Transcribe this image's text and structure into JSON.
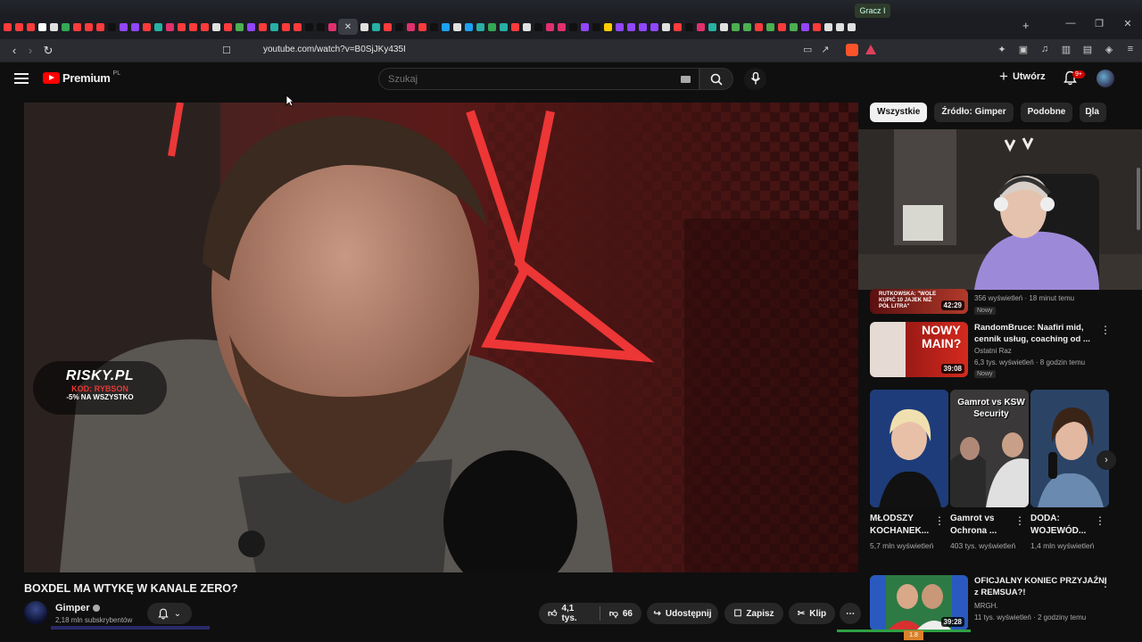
{
  "browser": {
    "gamer_badge": "Gracz I",
    "url": "youtube.com/watch?v=B0SjJKy435I",
    "win_controls": [
      "—",
      "❐",
      "✕"
    ],
    "new_tab": "+",
    "tab_colors": [
      "#ff3b3b",
      "#ff3b3b",
      "#ff3b3b",
      "#ffffff",
      "#e0e0e0",
      "#34a853",
      "#ff3b3b",
      "#ff3b3b",
      "#ff3b3b",
      "#111111",
      "#9146ff",
      "#9146ff",
      "#ff3b3b",
      "#27b0a4",
      "#e1306c",
      "#ff3b3b",
      "#ff3b3b",
      "#ff3b3b",
      "#e0e0e0",
      "#ff3b3b",
      "#4caf50",
      "#9146ff",
      "#ff3b3b",
      "#27b0a4",
      "#ff3b3b",
      "#ff3b3b",
      "#111111",
      "#111111",
      "#e1306c"
    ]
  },
  "masthead": {
    "logo_text": "Premium",
    "country": "PL",
    "search_placeholder": "Szukaj",
    "create_label": "Utwórz",
    "notif_count": "9+"
  },
  "video": {
    "promo_brand": "RISKY.PL",
    "promo_code": "KOD: RYBSON",
    "promo_offer": "-5% NA WSZYSTKO",
    "title": "BOXDEL MA WTYKĘ W KANALE ZERO?",
    "channel": "Gimper",
    "subscribers": "2,18 mln subskrybentów",
    "likes": "4,1 tys.",
    "dislikes": "66",
    "share": "Udostępnij",
    "save": "Zapisz",
    "clip": "Klip"
  },
  "chips": [
    "Wszystkie",
    "Źródło: Gimper",
    "Podobne",
    "Dla"
  ],
  "recommended": [
    {
      "title": "",
      "channel": "",
      "meta": "356 wyświetleń · 18 minut temu",
      "duration": "42:29",
      "badge": "Nowy",
      "thumb_text": "RUTKOWSKA: \"WOLE KUPIĆ 10 JAJEK NIŻ PÓŁ LITRA\""
    },
    {
      "title": "RandomBruce: Naafiri mid, cennik usług, coaching od ...",
      "channel": "Ostatni Raz",
      "meta": "6,3 tys. wyświetleń · 8 godzin temu",
      "duration": "39:08",
      "badge": "Nowy",
      "thumb_text": "NOWY MAIN?"
    },
    {
      "title": "OFICJALNY KONIEC PRZYJAŹNI z REMSUA?!",
      "channel": "MRGH.",
      "meta": "11 tys. wyświetleń · 2 godziny temu",
      "duration": "39:28",
      "badge": "",
      "thumb_text": ""
    }
  ],
  "shorts": [
    {
      "title": "MŁODSZY KOCHANEK...",
      "views": "5,7 mln wyświetleń",
      "thumb_text": ""
    },
    {
      "title": "Gamrot vs Ochrona ...",
      "views": "403 tys. wyświetleń",
      "thumb_text": "Gamrot vs KSW Security"
    },
    {
      "title": "DODA: WOJEWÓD...",
      "views": "1,4 mln wyświetleń",
      "thumb_text": ""
    }
  ],
  "status": {
    "orange_label": "1.8"
  }
}
